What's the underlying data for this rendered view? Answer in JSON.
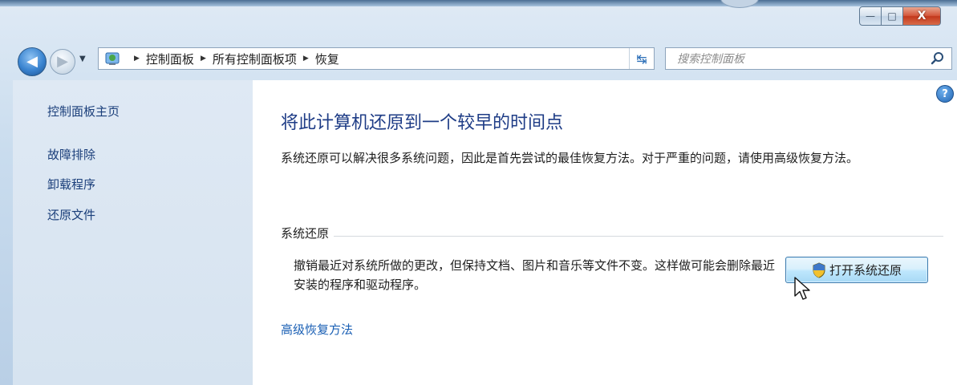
{
  "window": {
    "caption": {
      "minimize": "—",
      "maximize": "□",
      "close": "X"
    }
  },
  "navigation": {
    "breadcrumbs": [
      "控制面板",
      "所有控制面板项",
      "恢复"
    ],
    "search_placeholder": "搜索控制面板"
  },
  "sidebar": {
    "home": "控制面板主页",
    "links": [
      "故障排除",
      "卸载程序",
      "还原文件"
    ]
  },
  "main": {
    "help_glyph": "?",
    "title": "将此计算机还原到一个较早的时间点",
    "description": "系统还原可以解决很多系统问题，因此是首先尝试的最佳恢复方法。对于严重的问题，请使用高级恢复方法。",
    "system_restore": {
      "section_label": "系统还原",
      "description": "撤销最近对系统所做的更改，但保持文档、图片和音乐等文件不变。这样做可能会删除最近安装的程序和驱动程序。",
      "button_label": "打开系统还原"
    },
    "advanced_link": "高级恢复方法"
  },
  "colors": {
    "link": "#1a3e7a",
    "title": "#1e3c86",
    "sidebar_bg": "#d6e3f0"
  }
}
